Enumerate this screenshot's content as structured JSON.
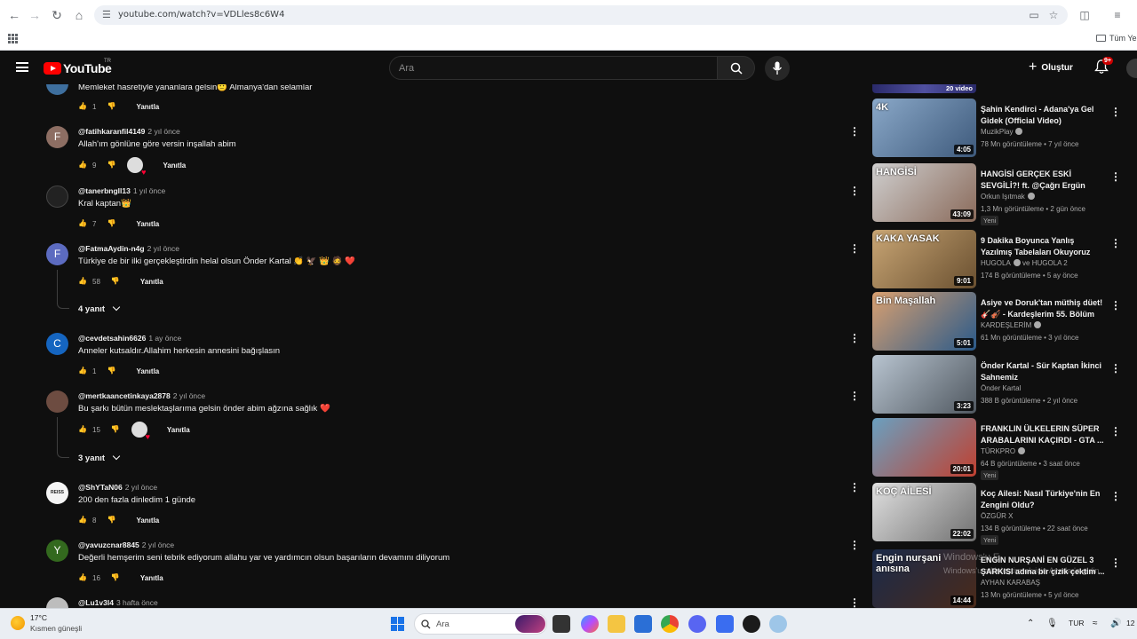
{
  "browser": {
    "url": "youtube.com/watch?v=VDLles8c6W4",
    "bookmark_folder": "Tüm Yer"
  },
  "header": {
    "logo_text": "YouTube",
    "country_code": "TR",
    "search_placeholder": "Ara",
    "create_label": "Oluştur",
    "notifications_badge": "9+"
  },
  "comments": [
    {
      "avatar_letter": "",
      "avatar_color": "#3e6f9e",
      "author": "",
      "time": "",
      "text": "Memleket hasretiyle yananlara gelsin🙂 Almanya'dan selamlar",
      "likes": "1",
      "reply_label": "Yanıtla",
      "hearted": false
    },
    {
      "avatar_letter": "F",
      "avatar_color": "#8d6e63",
      "author": "@fatihkaranfil4149",
      "time": "2 yıl önce",
      "text": "Allah'ım gönlüne göre versin inşallah abim",
      "likes": "9",
      "reply_label": "Yanıtla",
      "hearted": true
    },
    {
      "avatar_letter": "",
      "avatar_color": "#2a2a2a",
      "author": "@tanerbngll13",
      "time": "1 yıl önce",
      "text": "Kral kaptan👑",
      "likes": "7",
      "reply_label": "Yanıtla",
      "hearted": false
    },
    {
      "avatar_letter": "F",
      "avatar_color": "#5c6bc0",
      "author": "@FatmaAydin-n4g",
      "time": "2 yıl önce",
      "text": "Türkiye de bir ilki gerçekleştirdin helal olsun Önder Kartal 👏 🦅 👑 🧔 ❤️",
      "likes": "58",
      "reply_label": "Yanıtla",
      "hearted": false,
      "replies": "4 yanıt"
    },
    {
      "avatar_letter": "C",
      "avatar_color": "#1565c0",
      "author": "@cevdetsahin6626",
      "time": "1 ay önce",
      "text": "Anneler kutsaldır.Allahim herkesin annesini bağışlasın",
      "likes": "1",
      "reply_label": "Yanıtla",
      "hearted": false
    },
    {
      "avatar_letter": "",
      "avatar_color": "#6d4c41",
      "author": "@mertkaancetinkaya2878",
      "time": "2 yıl önce",
      "text": "Bu şarkı bütün meslektaşlarıma gelsin önder abim ağzına sağlık ❤️",
      "likes": "15",
      "reply_label": "Yanıtla",
      "hearted": true,
      "replies": "3 yanıt"
    },
    {
      "avatar_letter": "REISS",
      "avatar_color": "#f5f5f5",
      "author": "@ShYTaN06",
      "time": "2 yıl önce",
      "text": "200 den fazla dinledim 1 günde",
      "likes": "8",
      "reply_label": "Yanıtla",
      "hearted": false
    },
    {
      "avatar_letter": "Y",
      "avatar_color": "#33691e",
      "author": "@yavuzcnar8845",
      "time": "2 yıl önce",
      "text": "Değerli hemşerim seni tebrik ediyorum allahu yar ve yardımcın olsun başarıların devamını diliyorum",
      "likes": "16",
      "reply_label": "Yanıtla",
      "hearted": false
    },
    {
      "avatar_letter": "",
      "avatar_color": "#bdbdbd",
      "author": "@Lu1v3l4",
      "time": "3 hafta önce",
      "text": "",
      "likes": "",
      "reply_label": "",
      "hearted": false
    }
  ],
  "sidebar": {
    "playlist_count": "20 video",
    "videos": [
      {
        "title": "Şahin Kendirci - Adana'ya Gel Gidek (Official Video)",
        "channel": "MuzikPlay",
        "verified": true,
        "meta": "78 Mn görüntüleme • 7 yıl önce",
        "duration": "4:05",
        "thumb_label": "4K",
        "thumb_colors": [
          "#8aa8c8",
          "#3e5a7c"
        ],
        "badge": ""
      },
      {
        "title": "HANGİSİ GERÇEK ESKİ SEVGİLİ?! ft. @Çağrı Ergün",
        "channel": "Orkun Işıtmak",
        "verified": true,
        "meta": "1,3 Mn görüntüleme • 2 gün önce",
        "duration": "43:09",
        "thumb_label": "HANGİSİ",
        "thumb_colors": [
          "#cfcfcf",
          "#8a6a5a"
        ],
        "badge": "Yeni"
      },
      {
        "title": "9 Dakika Boyunca Yanlış Yazılmış Tabelaları Okuyoruz",
        "channel": "HUGOLA",
        "channel2": "ve HUGOLA 2",
        "verified": true,
        "meta": "174 B görüntüleme • 5 ay önce",
        "duration": "9:01",
        "thumb_label": "KAKA YASAK",
        "thumb_colors": [
          "#c8a574",
          "#6a5030"
        ],
        "badge": ""
      },
      {
        "title": "Asiye ve Doruk'tan müthiş düet! 🎸🎻 - Kardeşlerim 55. Bölüm",
        "channel": "KARDEŞLERİM",
        "verified": true,
        "meta": "61 Mn görüntüleme • 3 yıl önce",
        "duration": "5:01",
        "thumb_label": "Bin Maşallah",
        "thumb_colors": [
          "#d9a070",
          "#2a5a8a"
        ],
        "badge": ""
      },
      {
        "title": "Önder Kartal - Sür Kaptan İkinci Sahnemiz",
        "channel": "Önder Kartal",
        "verified": false,
        "meta": "388 B görüntüleme • 2 yıl önce",
        "duration": "3:23",
        "thumb_label": "",
        "thumb_colors": [
          "#b8c4d0",
          "#505860"
        ],
        "badge": ""
      },
      {
        "title": "FRANKLIN ÜLKELERIN SÜPER ARABALARINI KAÇIRDI - GTA ...",
        "channel": "TÜRKPRO",
        "verified": true,
        "meta": "64 B görüntüleme • 3 saat önce",
        "duration": "20:01",
        "thumb_label": "",
        "thumb_colors": [
          "#6aa0c0",
          "#c04030"
        ],
        "badge": "Yeni"
      },
      {
        "title": "Koç Ailesi: Nasıl Türkiye'nin En Zengini Oldu?",
        "channel": "ÖZGÜR X",
        "verified": false,
        "meta": "134 B görüntüleme • 22 saat önce",
        "duration": "22:02",
        "thumb_label": "KOÇ AİLESİ",
        "thumb_colors": [
          "#e0e0e0",
          "#707070"
        ],
        "badge": "Yeni"
      },
      {
        "title": "ENGİN NURŞANİ EN GÜZEL 3 ŞARKISI adına bir çizik çektim ...",
        "channel": "AYHAN KARABAŞ",
        "verified": false,
        "meta": "13 Mn görüntüleme • 5 yıl önce",
        "duration": "14:44",
        "thumb_label": "Engin nurşani anısına",
        "thumb_colors": [
          "#1a2a4a",
          "#4a2a1a"
        ],
        "badge": ""
      }
    ]
  },
  "overlay": {
    "watermark_line1": "Windows'u E",
    "watermark_line2": "Windows'u etkinleştirmek için Ayarlar'a gidin."
  },
  "taskbar": {
    "temperature": "17°C",
    "weather_desc": "Kısmen güneşli",
    "search_placeholder": "Ara",
    "language": "TUR",
    "clock_partial": "12"
  }
}
